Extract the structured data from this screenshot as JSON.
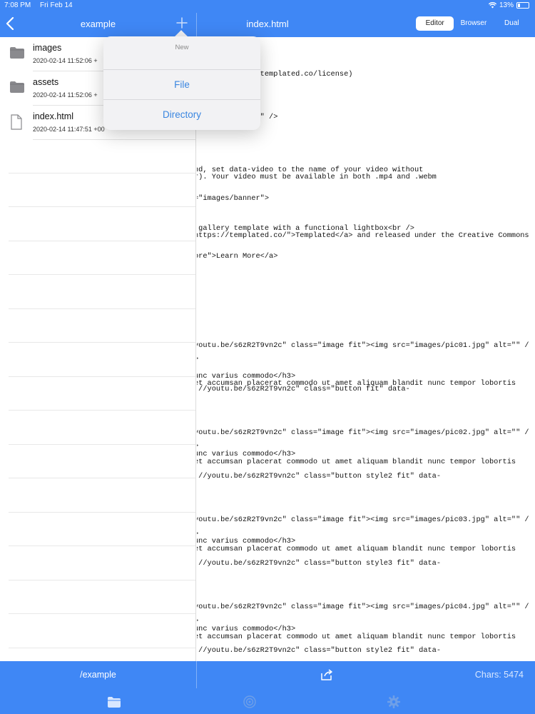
{
  "status": {
    "time": "7:08 PM",
    "date": "Fri Feb 14",
    "battery": "13%"
  },
  "header": {
    "left_title": "example",
    "right_title": "index.html",
    "tabs": [
      {
        "label": "Editor",
        "active": true
      },
      {
        "label": "Browser",
        "active": false
      },
      {
        "label": "Dual",
        "active": false
      }
    ]
  },
  "files": [
    {
      "name": "images",
      "date": "2020-02-14 11:52:06 +",
      "icon": "folder-icon"
    },
    {
      "name": "assets",
      "date": "2020-02-14 11:52:06 +",
      "icon": "folder-icon"
    },
    {
      "name": "index.html",
      "date": "2020-02-14 11:47:51 +00",
      "icon": "document-icon"
    }
  ],
  "popover": {
    "header": "New",
    "items": [
      {
        "label": "File"
      },
      {
        "label": "Directory"
      }
    ]
  },
  "code_lines": [
    {
      "text": "a 3.0 license (templated.co/license)",
      "row": 0
    },
    {
      "text": "initial-scale=1\" />",
      "row": 1
    },
    {
      "text": "nd, set data-video to the name of your video without",
      "row": 2
    },
    {
      "text": "r). Your video must be available in both .mp4 and .webm",
      "row": 3
    },
    {
      "text": "=\"images/banner\">",
      "row": 4
    },
    {
      "text": " gallery template with a functional lightbox<br />",
      "row": 5
    },
    {
      "text": "https://templated.co/\">Templated</a> and released under the Creative Commons",
      "row": 6
    },
    {
      "text": "ore\">Learn More</a>",
      "row": 7
    },
    {
      "text": "youtu.be/s6zR2T9vn2c\" class=\"image fit\"><img src=\"images/pic01.jpg\" alt=\"\" /",
      "row": 8
    },
    {
      "text": ">",
      "row": 9
    },
    {
      "text": "unc varius commodo</h3>",
      "row": 10
    },
    {
      "text": "et accumsan placerat commodo ut amet aliquam blandit nunc tempor lobortis",
      "row": 11
    },
    {
      "text": "://youtu.be/s6zR2T9vn2c\" class=\"button fit\" data-",
      "row": 12
    },
    {
      "text": "youtu.be/s6zR2T9vn2c\" class=\"image fit\"><img src=\"images/pic02.jpg\" alt=\"\" /",
      "row": 13
    },
    {
      "text": ">",
      "row": 14
    },
    {
      "text": "unc varius commodo</h3>",
      "row": 15
    },
    {
      "text": "et accumsan placerat commodo ut amet aliquam blandit nunc tempor lobortis",
      "row": 16
    },
    {
      "text": "://youtu.be/s6zR2T9vn2c\" class=\"button style2 fit\" data-",
      "row": 17
    },
    {
      "text": "youtu.be/s6zR2T9vn2c\" class=\"image fit\"><img src=\"images/pic03.jpg\" alt=\"\" /",
      "row": 18
    },
    {
      "text": ">",
      "row": 19
    },
    {
      "text": "unc varius commodo</h3>",
      "row": 20
    },
    {
      "text": "et accumsan placerat commodo ut amet aliquam blandit nunc tempor lobortis",
      "row": 21
    },
    {
      "text": "://youtu.be/s6zR2T9vn2c\" class=\"button style3 fit\" data-",
      "row": 22
    },
    {
      "text": "youtu.be/s6zR2T9vn2c\" class=\"image fit\"><img src=\"images/pic04.jpg\" alt=\"\" /",
      "row": 23
    },
    {
      "text": ">",
      "row": 24
    },
    {
      "text": "unc varius commodo</h3>",
      "row": 25
    },
    {
      "text": "et accumsan placerat commodo ut amet aliquam blandit nunc tempor lobortis",
      "row": 26
    },
    {
      "text": "://youtu.be/s6zR2T9vn2c\" class=\"button style2 fit\" data-",
      "row": 27
    }
  ],
  "bottom": {
    "path": "/example",
    "chars": "Chars: 5474"
  },
  "tabbar": {
    "items": [
      "folder-icon",
      "target-icon",
      "gear-icon"
    ]
  },
  "colors": {
    "accent": "#3f87f5",
    "link": "#3a86e0"
  }
}
